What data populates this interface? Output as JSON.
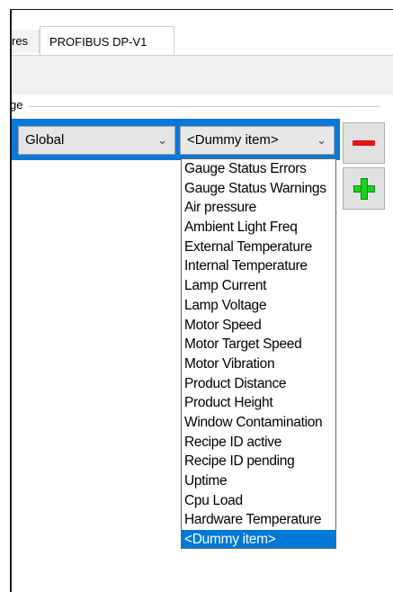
{
  "tabs": {
    "prev_label": "res",
    "active_label": "PROFIBUS DP-V1"
  },
  "group": {
    "label": "ge"
  },
  "row": {
    "scope_value": "Global",
    "item_value": "<Dummy item>"
  },
  "dropdown": {
    "options": [
      "Gauge Status Errors",
      "Gauge Status Warnings",
      "Air pressure",
      "Ambient Light Freq",
      "External Temperature",
      "Internal Temperature",
      "Lamp Current",
      "Lamp Voltage",
      "Motor Speed",
      "Motor Target Speed",
      "Motor Vibration",
      "Product Distance",
      "Product Height",
      "Window Contamination",
      "Recipe ID active",
      "Recipe ID pending",
      "Uptime",
      "Cpu Load",
      "Hardware Temperature",
      "<Dummy item>"
    ],
    "selected_index": 19
  },
  "icons": {
    "remove": "minus-icon",
    "add": "plus-icon",
    "dropdown_arrow": "chevron-down-icon"
  },
  "colors": {
    "selection_blue": "#0078d7",
    "remove_red": "#e01515",
    "add_green": "#1fd11f"
  }
}
